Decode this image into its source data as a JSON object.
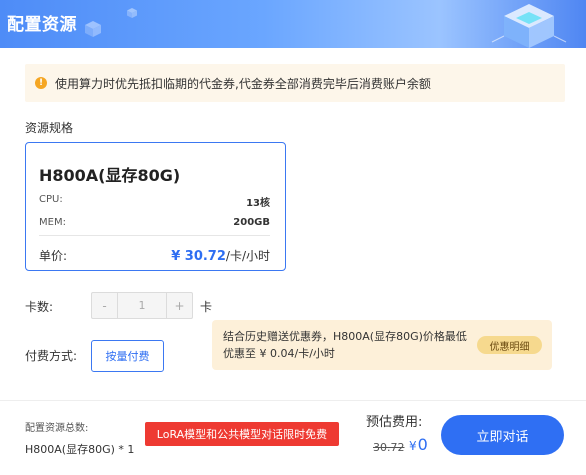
{
  "header": {
    "title": "配置资源"
  },
  "notice": {
    "text": "使用算力时优先抵扣临期的代金券,代金券全部消费完毕后消费账户余额"
  },
  "spec_section": {
    "label": "资源规格"
  },
  "spec_card": {
    "name": "H800A(显存80G)",
    "cpu_label": "CPU:",
    "cpu_value": "13核",
    "mem_label": "MEM:",
    "mem_value": "200GB",
    "price_label": "单价:",
    "price_value": "¥ 30.72",
    "price_unit": "/卡/小时"
  },
  "quantity": {
    "label": "卡数:",
    "minus": "-",
    "value": "1",
    "plus": "+",
    "suffix": "卡"
  },
  "payment": {
    "label": "付费方式:",
    "option": "按量付费"
  },
  "coupon": {
    "text": "结合历史赠送优惠券，H800A(显存80G)价格最低优惠至 ¥ 0.04/卡/小时",
    "badge": "优惠明细"
  },
  "footer": {
    "total_label": "配置资源总数:",
    "total_value": "H800A(显存80G) * 1",
    "promo": "LoRA模型和公共模型对话限时免费",
    "estimate_label": "预估费用:",
    "price_old": "30.72",
    "currency": "¥",
    "price_new": "0",
    "cta": "立即对话"
  },
  "colors": {
    "accent": "#2e6ef2",
    "promo_red": "#ee3a32",
    "notice_bg": "#fdf6ea",
    "coupon_bg": "#fdf0d9"
  },
  "icons": {
    "notice": "warning-icon",
    "header_deco": "cube-icon"
  }
}
